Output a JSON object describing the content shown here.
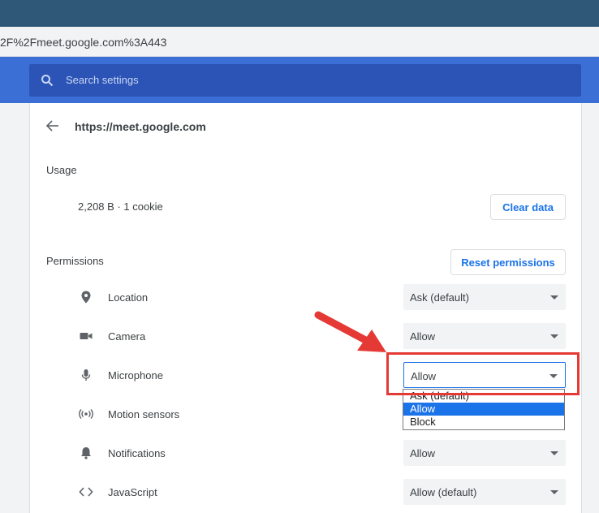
{
  "browser": {
    "address_text": "2F%2Fmeet.google.com%3A443"
  },
  "search": {
    "placeholder": "Search settings"
  },
  "site": {
    "title": "https://meet.google.com"
  },
  "usage": {
    "label": "Usage",
    "text": "2,208 B · 1 cookie",
    "clear_button": "Clear data"
  },
  "permissions": {
    "label": "Permissions",
    "reset_button": "Reset permissions",
    "items": [
      {
        "label": "Location",
        "value": "Ask (default)",
        "icon": "location-pin-icon"
      },
      {
        "label": "Camera",
        "value": "Allow",
        "icon": "camera-icon"
      },
      {
        "label": "Microphone",
        "value": "Allow",
        "icon": "microphone-icon"
      },
      {
        "label": "Motion sensors",
        "value": "",
        "icon": "motion-sensors-icon"
      },
      {
        "label": "Notifications",
        "value": "Allow",
        "icon": "bell-icon"
      },
      {
        "label": "JavaScript",
        "value": "Allow (default)",
        "icon": "code-icon"
      }
    ]
  },
  "dropdown": {
    "options": [
      "Ask (default)",
      "Allow",
      "Block"
    ],
    "selected": "Allow"
  },
  "colors": {
    "accent": "#1a73e8",
    "header": "#3b6fd6",
    "annotation": "#e53935"
  }
}
